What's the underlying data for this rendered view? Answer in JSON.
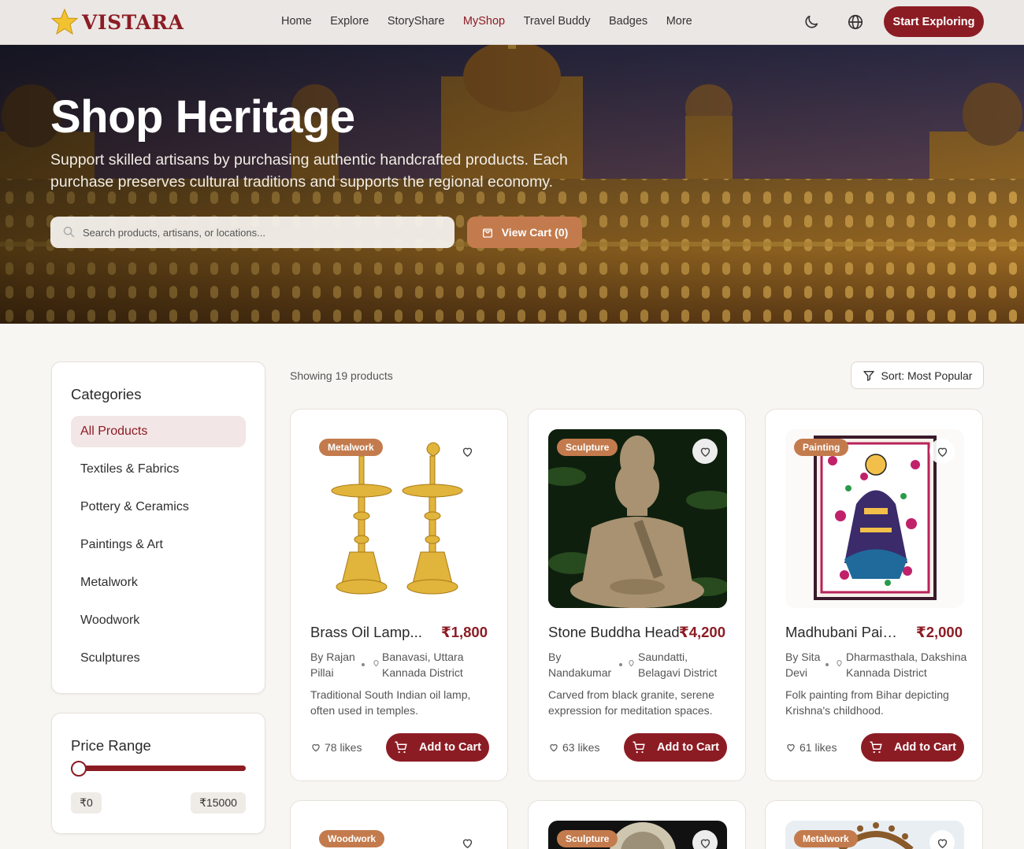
{
  "brand": {
    "name": "VISTARA"
  },
  "nav": {
    "items": [
      {
        "label": "Home",
        "active": false
      },
      {
        "label": "Explore",
        "active": false
      },
      {
        "label": "StoryShare",
        "active": false
      },
      {
        "label": "MyShop",
        "active": true
      },
      {
        "label": "Travel Buddy",
        "active": false
      },
      {
        "label": "Badges",
        "active": false
      },
      {
        "label": "More",
        "active": false
      }
    ],
    "cta": "Start Exploring"
  },
  "hero": {
    "title": "Shop Heritage",
    "subtitle": "Support skilled artisans by purchasing authentic handcrafted products. Each purchase preserves cultural traditions and supports the regional economy.",
    "search_placeholder": "Search products, artisans, or locations...",
    "cart_label": "View Cart (0)"
  },
  "sidebar": {
    "categories_title": "Categories",
    "categories": [
      {
        "label": "All Products",
        "active": true
      },
      {
        "label": "Textiles & Fabrics",
        "active": false
      },
      {
        "label": "Pottery & Ceramics",
        "active": false
      },
      {
        "label": "Paintings & Art",
        "active": false
      },
      {
        "label": "Metalwork",
        "active": false
      },
      {
        "label": "Woodwork",
        "active": false
      },
      {
        "label": "Sculptures",
        "active": false
      }
    ],
    "price_title": "Price Range",
    "price_min": "₹0",
    "price_max": "₹15000",
    "price_slider_value": 0
  },
  "toolbar": {
    "count": "Showing 19 products",
    "sort": "Sort: Most Popular"
  },
  "products": [
    {
      "category": "Metalwork",
      "name": "Brass Oil Lamp...",
      "price": "₹1,800",
      "by": "By Rajan Pillai",
      "location": "Banavasi, Uttara Kannada District",
      "desc": "Traditional South Indian oil lamp, often used in temples.",
      "likes": "78 likes",
      "add": "Add to Cart"
    },
    {
      "category": "Sculpture",
      "name": "Stone Buddha Head",
      "price": "₹4,200",
      "by": "By Nandakumar",
      "location": "Saundatti, Belagavi District",
      "desc": "Carved from black granite, serene expression for meditation spaces.",
      "likes": "63 likes",
      "add": "Add to Cart"
    },
    {
      "category": "Painting",
      "name": "Madhubani Paintin...",
      "price": "₹2,000",
      "by": "By Sita Devi",
      "location": "Dharmasthala, Dakshina Kannada District",
      "desc": "Folk painting from Bihar depicting Krishna's childhood.",
      "likes": "61 likes",
      "add": "Add to Cart"
    },
    {
      "category": "Woodwork"
    },
    {
      "category": "Sculpture"
    },
    {
      "category": "Metalwork"
    }
  ],
  "colors": {
    "brand": "#8c1c24",
    "accent": "#c37b4d",
    "background": "#f8f6f2"
  }
}
